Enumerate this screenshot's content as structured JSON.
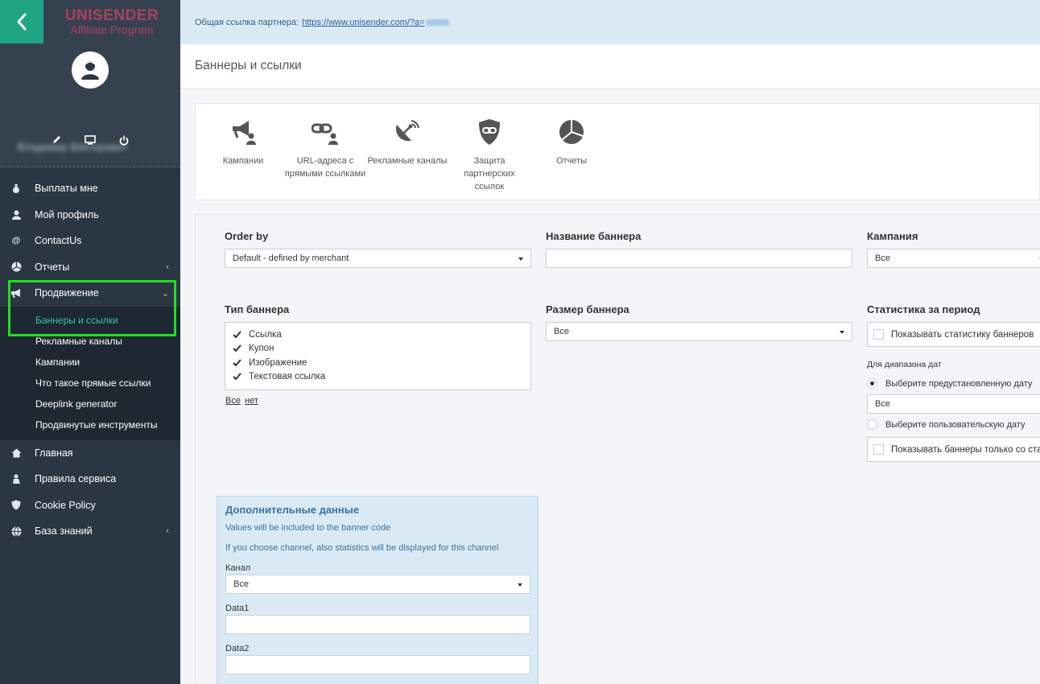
{
  "sidebar": {
    "logo_line1": "UNISENDER",
    "logo_line2": "Affiliate Program",
    "user_name": "Владимир Викторович",
    "menu": [
      {
        "label": "Выплаты мне",
        "icon": "money-bag-icon"
      },
      {
        "label": "Мой профиль",
        "icon": "user-icon"
      },
      {
        "label": "ContactUs",
        "icon": "at-icon"
      },
      {
        "label": "Отчеты",
        "icon": "pie-chart-icon"
      },
      {
        "label": "Продвижение",
        "icon": "megaphone-icon"
      }
    ],
    "submenu": [
      {
        "label": "Баннеры и ссылки"
      },
      {
        "label": "Рекламные каналы"
      },
      {
        "label": "Кампании"
      },
      {
        "label": "Что такое прямые ссылки"
      },
      {
        "label": "Deeplink generator"
      },
      {
        "label": "Продвинутые инструменты"
      }
    ],
    "menu_bottom": [
      {
        "label": "Главная",
        "icon": "home-icon"
      },
      {
        "label": "Правила сервиса",
        "icon": "rules-icon"
      },
      {
        "label": "Cookie Policy",
        "icon": "shield-icon"
      },
      {
        "label": "База знаний",
        "icon": "globe-icon"
      }
    ]
  },
  "topbar": {
    "label": "Общая ссылка партнера:",
    "link": "https://www.unisender.com/?a="
  },
  "page_title": "Баннеры и ссылки",
  "tools": [
    {
      "label": "Кампании",
      "icon": "megaphone-user-icon"
    },
    {
      "label": "URL-адреса с прямыми ссылками",
      "icon": "link-user-icon"
    },
    {
      "label": "Рекламные каналы",
      "icon": "satellite-icon"
    },
    {
      "label": "Защита партнерских ссылок",
      "icon": "shield-link-icon"
    },
    {
      "label": "Отчеты",
      "icon": "pie-chart-icon"
    }
  ],
  "filters": {
    "order_by_label": "Order by",
    "order_by_value": "Default - defined by merchant",
    "banner_name_label": "Название баннера",
    "banner_name_value": "",
    "campaign_label": "Кампания",
    "campaign_value": "Все",
    "banner_type_label": "Тип баннера",
    "banner_types": [
      "Ссылка",
      "Купон",
      "Изображение",
      "Текстовая ссылка"
    ],
    "select_all": "Все",
    "select_none": "нет",
    "banner_size_label": "Размер баннера",
    "banner_size_value": "Все",
    "stats_label": "Статистика за период",
    "show_stats": "Показывать статистику баннеров",
    "date_range_label": "Для диапазона дат",
    "preset_date": "Выберите предустановленную дату",
    "preset_value": "Все",
    "custom_date": "Выберите пользовательскую дату",
    "only_with_stats": "Показывать баннеры только со статистикой"
  },
  "extra": {
    "title": "Дополнительные данные",
    "line1": "Values will be included to the banner code",
    "line2": "If you choose channel, also statistics will be displayed for this channel",
    "channel_label": "Канал",
    "channel_value": "Все",
    "data1_label": "Data1",
    "data1_value": "",
    "data2_label": "Data2",
    "data2_value": ""
  },
  "colors": {
    "sidebar_bg": "#2b3643",
    "accent": "#1fa584",
    "logo": "#a9425f",
    "active_sub": "#36c6a7",
    "highlight": "#1ee01e"
  }
}
